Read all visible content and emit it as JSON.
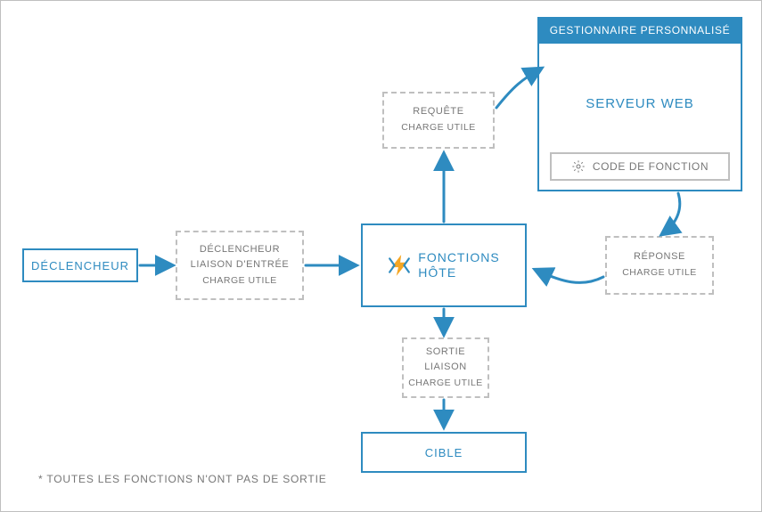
{
  "colors": {
    "accent": "#2e8bc0",
    "muted": "#777",
    "border": "#bfbfbf",
    "icon_yellow": "#f5a623",
    "icon_blue": "#2e8bc0"
  },
  "nodes": {
    "trigger": "DÉCLENCHEUR",
    "trigger_binding": {
      "line1": "DÉCLENCHEUR",
      "line2": "LIAISON D'ENTRÉE",
      "payload": "CHARGE UTILE"
    },
    "host": {
      "title": "FONCTIONS",
      "subtitle": "HÔTE"
    },
    "request": {
      "line1": "REQUÊTE",
      "payload": "CHARGE UTILE"
    },
    "response": {
      "line1": "RÉPONSE",
      "payload": "CHARGE UTILE"
    },
    "output": {
      "line1": "SORTIE",
      "line2": "LIAISON",
      "payload": "CHARGE UTILE"
    },
    "target": "CIBLE"
  },
  "custom_handler": {
    "header": "GESTIONNAIRE PERSONNALISÉ",
    "server": "SERVEUR WEB",
    "code": "CODE DE FONCTION"
  },
  "footnote": "*  TOUTES LES FONCTIONS N'ONT PAS DE SORTIE",
  "icons": {
    "lightning": "lightning-icon",
    "gear": "gear-icon"
  }
}
